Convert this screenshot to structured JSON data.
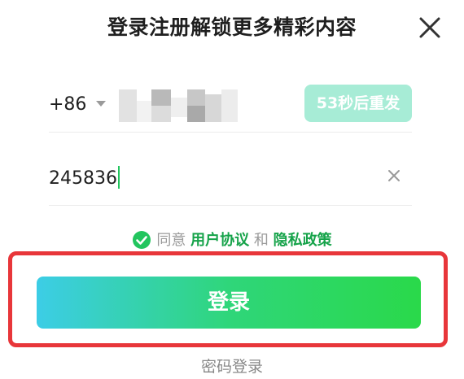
{
  "dialog": {
    "title": "登录注册解锁更多精彩内容",
    "close_icon": "close-icon"
  },
  "phone": {
    "country_code": "+86",
    "country_caret_icon": "chevron-down-icon",
    "number_masked": true,
    "resend_label": "53秒后重发"
  },
  "code": {
    "value": "245836",
    "clear_icon": "clear-icon"
  },
  "agreement": {
    "checked": true,
    "check_icon": "check-circle-icon",
    "prefix": "同意",
    "terms_link": "用户协议",
    "conjunction": "和",
    "privacy_link": "隐私政策"
  },
  "actions": {
    "login_label": "登录",
    "password_login_label": "密码登录"
  },
  "colors": {
    "accent_green": "#22c55e",
    "link_green": "#16a34a",
    "resend_bg": "#a7ecd6",
    "highlight_red": "#e8363a",
    "button_gradient_start": "#3ccde6",
    "button_gradient_end": "#2ad94a"
  }
}
